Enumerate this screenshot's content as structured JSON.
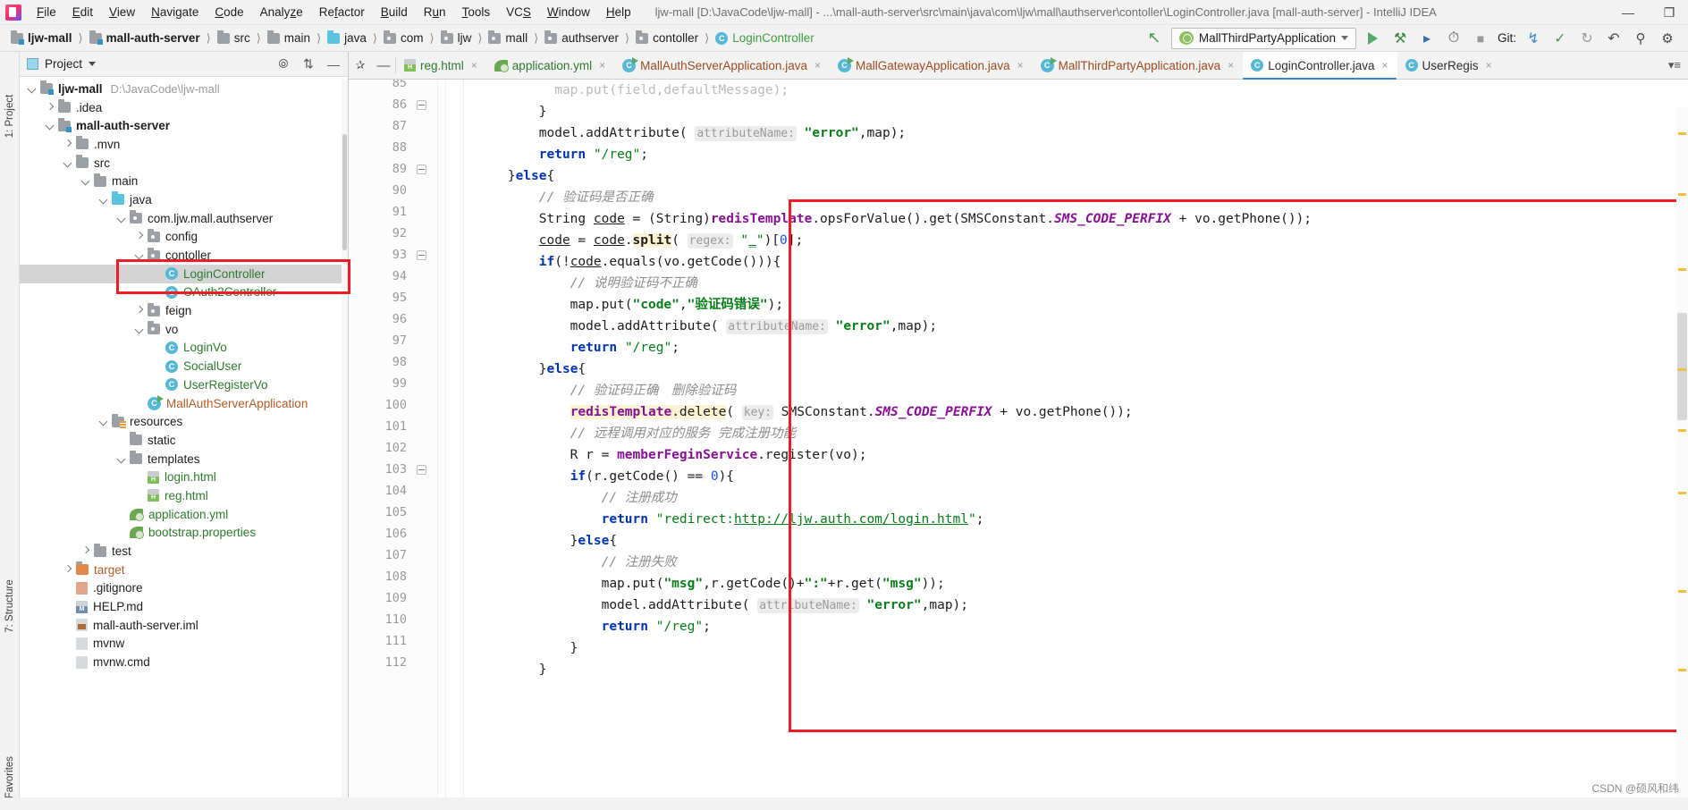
{
  "window": {
    "title": "ljw-mall [D:\\JavaCode\\ljw-mall] - ...\\mall-auth-server\\src\\main\\java\\com\\ljw\\mall\\authserver\\contoller\\LoginController.java [mall-auth-server] - IntelliJ IDEA",
    "minimize_label": "—",
    "restore_label": "❐",
    "app_icon": "intellij-idea-icon"
  },
  "menu": {
    "items": [
      "File",
      "Edit",
      "View",
      "Navigate",
      "Code",
      "Analyze",
      "Refactor",
      "Build",
      "Run",
      "Tools",
      "VCS",
      "Window",
      "Help"
    ]
  },
  "breadcrumb": {
    "items": [
      {
        "label": "ljw-mall",
        "icon": "module-folder-icon",
        "bold": true
      },
      {
        "label": "mall-auth-server",
        "icon": "module-folder-icon",
        "bold": true
      },
      {
        "label": "src",
        "icon": "folder-icon",
        "bold": false
      },
      {
        "label": "main",
        "icon": "folder-icon",
        "bold": false
      },
      {
        "label": "java",
        "icon": "source-folder-icon",
        "bold": false
      },
      {
        "label": "com",
        "icon": "package-icon",
        "bold": false
      },
      {
        "label": "ljw",
        "icon": "package-icon",
        "bold": false
      },
      {
        "label": "mall",
        "icon": "package-icon",
        "bold": false
      },
      {
        "label": "authserver",
        "icon": "package-icon",
        "bold": false
      },
      {
        "label": "contoller",
        "icon": "package-icon",
        "bold": false
      },
      {
        "label": "LoginController",
        "icon": "java-class-icon",
        "bold": false,
        "green": true
      }
    ]
  },
  "toolbar": {
    "run_config": "MallThirdPartyApplication",
    "run_config_icon": "spring-boot-icon",
    "run_button": "run-icon",
    "debug_button": "debug-icon",
    "run_coverage_button": "run-with-coverage-icon",
    "profiler_button": "profiler-icon",
    "stop_button": "stop-icon",
    "git_label": "Git:",
    "git_update_button": "update-project-icon",
    "git_commit_button": "commit-icon",
    "git_rollback_button": "rollback-icon",
    "undo_button": "undo-icon",
    "search_button": "search-everywhere-icon",
    "settings_button": "settings-icon"
  },
  "left_strips": {
    "project": "1: Project",
    "structure": "7: Structure",
    "favorites": "2: Favorites"
  },
  "project_panel": {
    "title": "Project",
    "locate_icon": "locate-file-icon",
    "collapse_icon": "collapse-all-icon",
    "hide_icon": "hide-icon",
    "tree": [
      {
        "depth": 0,
        "arrow": "open",
        "icon": "module-folder-icon",
        "label": "ljw-mall",
        "bold": true,
        "path": "D:\\JavaCode\\ljw-mall"
      },
      {
        "depth": 1,
        "arrow": "closed",
        "icon": "folder-icon",
        "label": ".idea"
      },
      {
        "depth": 1,
        "arrow": "open",
        "icon": "module-folder-icon",
        "label": "mall-auth-server",
        "bold": true
      },
      {
        "depth": 2,
        "arrow": "closed",
        "icon": "folder-icon",
        "label": ".mvn"
      },
      {
        "depth": 2,
        "arrow": "open",
        "icon": "folder-icon",
        "label": "src"
      },
      {
        "depth": 3,
        "arrow": "open",
        "icon": "folder-icon",
        "label": "main"
      },
      {
        "depth": 4,
        "arrow": "open",
        "icon": "source-folder-icon",
        "label": "java"
      },
      {
        "depth": 5,
        "arrow": "open",
        "icon": "package-icon",
        "label": "com.ljw.mall.authserver"
      },
      {
        "depth": 6,
        "arrow": "closed",
        "icon": "package-icon",
        "label": "config"
      },
      {
        "depth": 6,
        "arrow": "open",
        "icon": "package-icon",
        "label": "contoller"
      },
      {
        "depth": 7,
        "arrow": "none",
        "icon": "java-class-icon",
        "label": "LoginController",
        "green": true,
        "selected": true
      },
      {
        "depth": 7,
        "arrow": "none",
        "icon": "java-class-icon",
        "label": "OAuth2Controller",
        "green": true
      },
      {
        "depth": 6,
        "arrow": "closed",
        "icon": "package-icon",
        "label": "feign"
      },
      {
        "depth": 6,
        "arrow": "open",
        "icon": "package-icon",
        "label": "vo"
      },
      {
        "depth": 7,
        "arrow": "none",
        "icon": "java-class-icon",
        "label": "LoginVo",
        "green": true
      },
      {
        "depth": 7,
        "arrow": "none",
        "icon": "java-class-icon",
        "label": "SocialUser",
        "green": true
      },
      {
        "depth": 7,
        "arrow": "none",
        "icon": "java-class-icon",
        "label": "UserRegisterVo",
        "green": true
      },
      {
        "depth": 6,
        "arrow": "none",
        "icon": "spring-boot-run-icon",
        "label": "MallAuthServerApplication",
        "orange": true
      },
      {
        "depth": 4,
        "arrow": "open",
        "icon": "resources-folder-icon",
        "label": "resources"
      },
      {
        "depth": 5,
        "arrow": "none",
        "icon": "folder-icon",
        "label": "static"
      },
      {
        "depth": 5,
        "arrow": "open",
        "icon": "folder-icon",
        "label": "templates"
      },
      {
        "depth": 6,
        "arrow": "none",
        "icon": "html-file-icon",
        "label": "login.html",
        "green": true
      },
      {
        "depth": 6,
        "arrow": "none",
        "icon": "html-file-icon",
        "label": "reg.html",
        "green": true
      },
      {
        "depth": 5,
        "arrow": "none",
        "icon": "yaml-spring-icon",
        "label": "application.yml",
        "green": true
      },
      {
        "depth": 5,
        "arrow": "none",
        "icon": "properties-spring-icon",
        "label": "bootstrap.properties",
        "green": true
      },
      {
        "depth": 3,
        "arrow": "closed",
        "icon": "folder-icon",
        "label": "test"
      },
      {
        "depth": 2,
        "arrow": "closed",
        "icon": "excluded-folder-icon",
        "label": "target",
        "orange": true
      },
      {
        "depth": 2,
        "arrow": "none",
        "icon": "gitignore-icon",
        "label": ".gitignore"
      },
      {
        "depth": 2,
        "arrow": "none",
        "icon": "markdown-icon",
        "label": "HELP.md"
      },
      {
        "depth": 2,
        "arrow": "none",
        "icon": "iml-module-icon",
        "label": "mall-auth-server.iml"
      },
      {
        "depth": 2,
        "arrow": "none",
        "icon": "file-icon",
        "label": "mvnw"
      },
      {
        "depth": 2,
        "arrow": "none",
        "icon": "file-icon",
        "label": "mvnw.cmd"
      }
    ]
  },
  "editor": {
    "tabs": [
      {
        "label": "reg.html",
        "icon": "html-file-icon",
        "color": "green",
        "active": false
      },
      {
        "label": "application.yml",
        "icon": "yaml-spring-icon",
        "color": "green",
        "active": false
      },
      {
        "label": "MallAuthServerApplication.java",
        "icon": "spring-boot-run-icon",
        "color": "brown",
        "active": false
      },
      {
        "label": "MallGatewayApplication.java",
        "icon": "spring-boot-run-icon",
        "color": "brown",
        "active": false
      },
      {
        "label": "MallThirdPartyApplication.java",
        "icon": "spring-boot-run-icon",
        "color": "brown",
        "active": false
      },
      {
        "label": "LoginController.java",
        "icon": "java-class-icon",
        "color": "plain",
        "active": true
      },
      {
        "label": "UserRegis",
        "icon": "java-class-icon",
        "color": "plain",
        "active": false
      }
    ],
    "tab_close_label": "×",
    "pin_icon": "pin-icon",
    "minimize_icon": "minimize-icon",
    "overflow_icon": "tab-list-icon",
    "first_visible_line": 85,
    "last_visible_line": 112,
    "lines": [
      {
        "n": 85,
        "partial": true
      },
      {
        "n": 86,
        "fold": true
      },
      {
        "n": 87
      },
      {
        "n": 88
      },
      {
        "n": 89,
        "fold": true
      },
      {
        "n": 90
      },
      {
        "n": 91
      },
      {
        "n": 92
      },
      {
        "n": 93,
        "fold": true
      },
      {
        "n": 94
      },
      {
        "n": 95
      },
      {
        "n": 96
      },
      {
        "n": 97
      },
      {
        "n": 98
      },
      {
        "n": 99
      },
      {
        "n": 100
      },
      {
        "n": 101
      },
      {
        "n": 102
      },
      {
        "n": 103,
        "fold": true
      },
      {
        "n": 104
      },
      {
        "n": 105
      },
      {
        "n": 106
      },
      {
        "n": 107
      },
      {
        "n": 108
      },
      {
        "n": 109
      },
      {
        "n": 110
      },
      {
        "n": 111
      },
      {
        "n": 112
      }
    ],
    "code_text": [
      "map.put(field,defaultMessage);",
      "}",
      "model.addAttribute( attributeName: \"error\",map);",
      "return \"/reg\";",
      "}else{",
      "// 验证码是否正确",
      "String code = (String)redisTemplate.opsForValue().get(SMSConstant.SMS_CODE_PERFIX + vo.getPhone());",
      "code = code.split( regex: \"_\")[0];",
      "if(!code.equals(vo.getCode())){",
      "// 说明验证码不正确",
      "map.put(\"code\",\"验证码错误\");",
      "model.addAttribute( attributeName: \"error\",map);",
      "return \"/reg\";",
      "}else{",
      "// 验证码正确  删除验证码",
      "redisTemplate.delete( key: SMSConstant.SMS_CODE_PERFIX + vo.getPhone());",
      "// 远程调用对应的服务 完成注册功能",
      "R r = memberFeginService.register(vo);",
      "if(r.getCode() == 0){",
      "// 注册成功",
      "return \"redirect:http://ljw.auth.com/login.html\";",
      "}else{",
      "// 注册失败",
      "map.put(\"msg\",r.getCode()+\":\"+r.get(\"msg\"));",
      "model.addAttribute( attributeName: \"error\",map);",
      "return \"/reg\";",
      "}",
      "}"
    ]
  },
  "annotations": {
    "tree_highlight": "red-rectangle-around-logincontroller",
    "code_highlight": "red-rectangle-around-code-block",
    "highlight_color": "#ee1c24"
  },
  "watermark": {
    "text": "CSDN @硕风和纬"
  }
}
